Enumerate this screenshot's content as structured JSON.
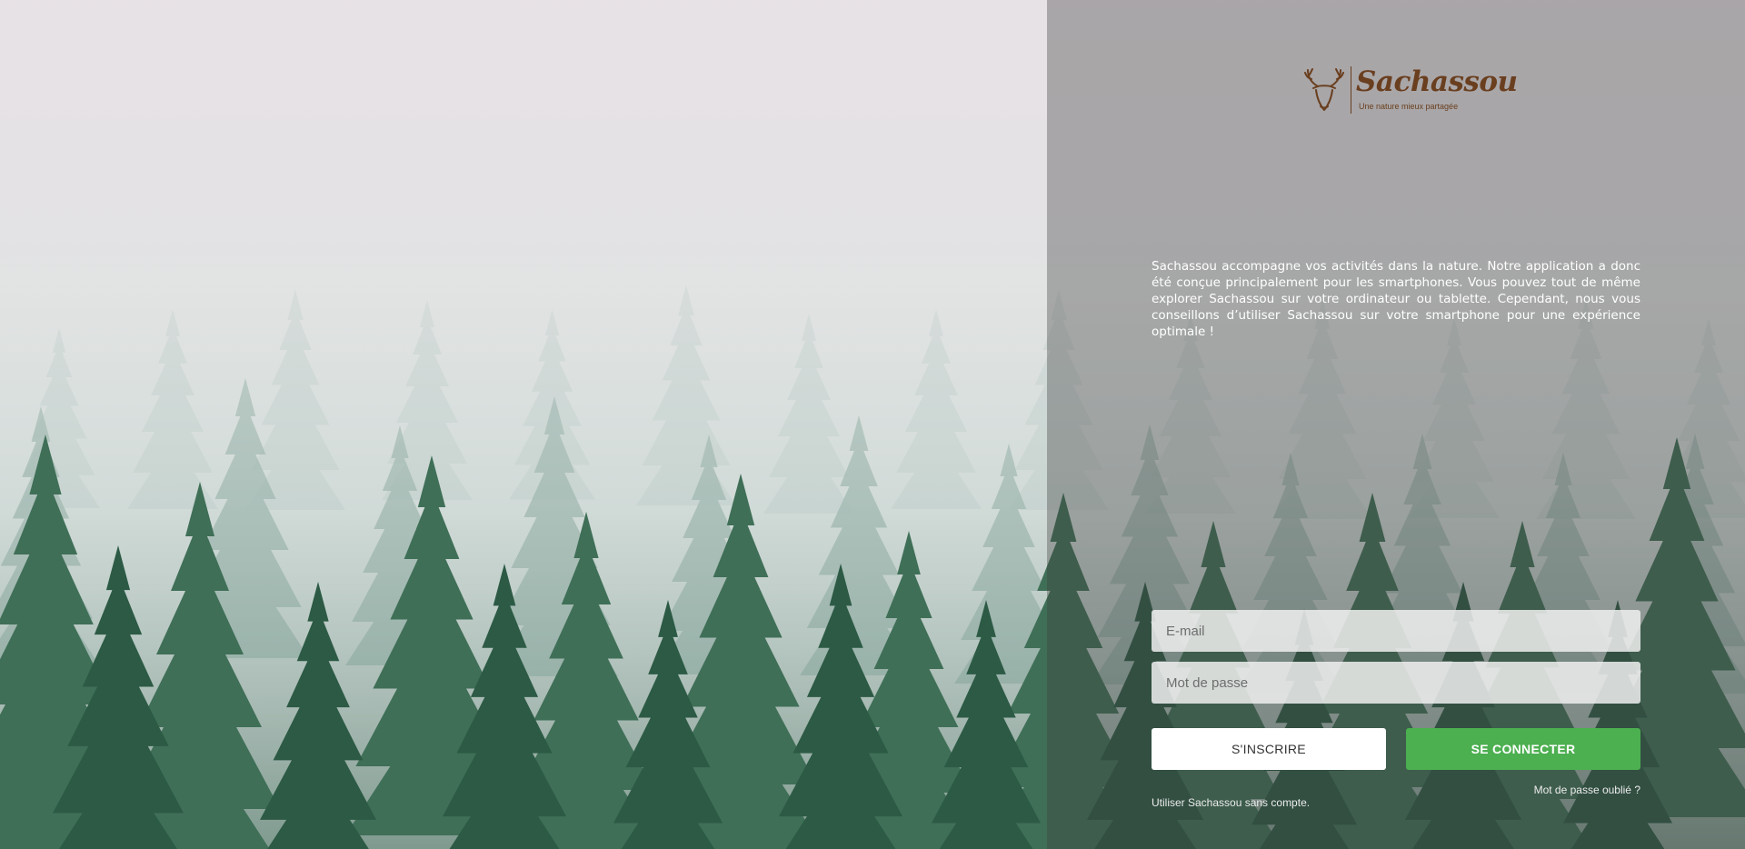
{
  "brand": {
    "name": "Sachassou",
    "tagline": "Une nature mieux partagée",
    "color": "#6a3f1f"
  },
  "intro": {
    "text": "Sachassou accompagne vos activités dans la nature. Notre application a donc été conçue principalement pour les smartphones. Vous pouvez tout de même explorer Sachassou sur votre ordinateur ou tablette. Cependant, nous vous conseillons d’utiliser Sachassou sur votre smartphone pour une expérience optimale !"
  },
  "login_form": {
    "email_placeholder": "E-mail",
    "email_value": "",
    "password_placeholder": "Mot de passe",
    "password_value": "",
    "register_label": "S'INSCRIRE",
    "login_label": "SE CONNECTER",
    "forgot_password_label": "Mot de passe oublié ?",
    "guest_label": "Utiliser Sachassou sans compte."
  },
  "colors": {
    "login_button": "#4caf50",
    "register_button": "#ffffff"
  },
  "icons": {
    "logo_mark": "deer-head-icon"
  }
}
